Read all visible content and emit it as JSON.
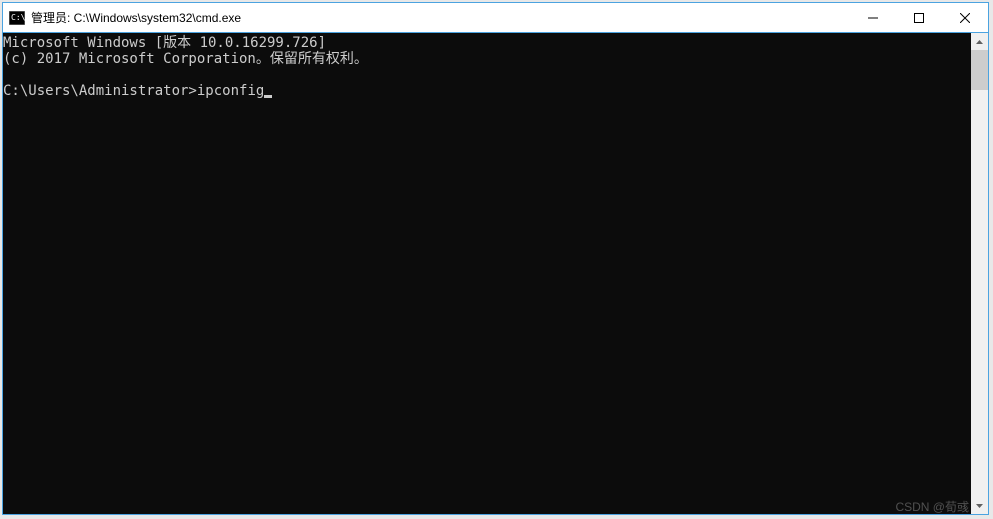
{
  "titlebar": {
    "title": "管理员: C:\\Windows\\system32\\cmd.exe"
  },
  "terminal": {
    "line1": "Microsoft Windows [版本 10.0.16299.726]",
    "line2": "(c) 2017 Microsoft Corporation。保留所有权利。",
    "prompt": "C:\\Users\\Administrator>",
    "command": "ipconfig"
  },
  "watermark": "CSDN @荀彧"
}
